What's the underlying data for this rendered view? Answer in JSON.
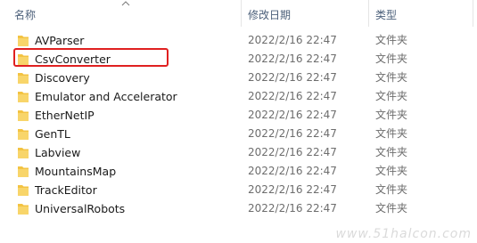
{
  "columns": {
    "name": "名称",
    "date": "修改日期",
    "type": "类型"
  },
  "sort": {
    "column": "name",
    "icon": "sort-up-chevron-icon"
  },
  "folder_color": "#f3c342",
  "highlight_color": "#e02020",
  "items": [
    {
      "name": "AVParser",
      "date": "2022/2/16 22:47",
      "type": "文件夹"
    },
    {
      "name": "CsvConverter",
      "date": "2022/2/16 22:47",
      "type": "文件夹",
      "highlighted": true
    },
    {
      "name": "Discovery",
      "date": "2022/2/16 22:47",
      "type": "文件夹"
    },
    {
      "name": "Emulator and Accelerator",
      "date": "2022/2/16 22:47",
      "type": "文件夹"
    },
    {
      "name": "EtherNetIP",
      "date": "2022/2/16 22:47",
      "type": "文件夹"
    },
    {
      "name": "GenTL",
      "date": "2022/2/16 22:47",
      "type": "文件夹"
    },
    {
      "name": "Labview",
      "date": "2022/2/16 22:47",
      "type": "文件夹"
    },
    {
      "name": "MountainsMap",
      "date": "2022/2/16 22:47",
      "type": "文件夹"
    },
    {
      "name": "TrackEditor",
      "date": "2022/2/16 22:47",
      "type": "文件夹"
    },
    {
      "name": "UniversalRobots",
      "date": "2022/2/16 22:47",
      "type": "文件夹"
    }
  ],
  "watermark": "www.51halcon.com"
}
